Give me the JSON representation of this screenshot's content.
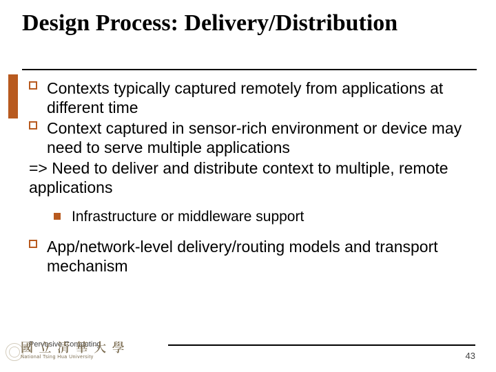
{
  "title": "Design Process: Delivery/Distribution",
  "bullets": {
    "b1": "Contexts typically captured remotely from applications at different time",
    "b2": "Context captured in sensor-rich environment or device may need to serve multiple applications",
    "arrow": "=> Need to deliver and distribute context to multiple, remote applications",
    "sub1": "Infrastructure or middleware support",
    "b3": "App/network-level delivery/routing models and transport mechanism"
  },
  "footer": {
    "course": "Pervasive Computing",
    "uni_cn": "國 立 清 華 大 學",
    "uni_en": "National Tsing Hua University",
    "page": "43"
  }
}
